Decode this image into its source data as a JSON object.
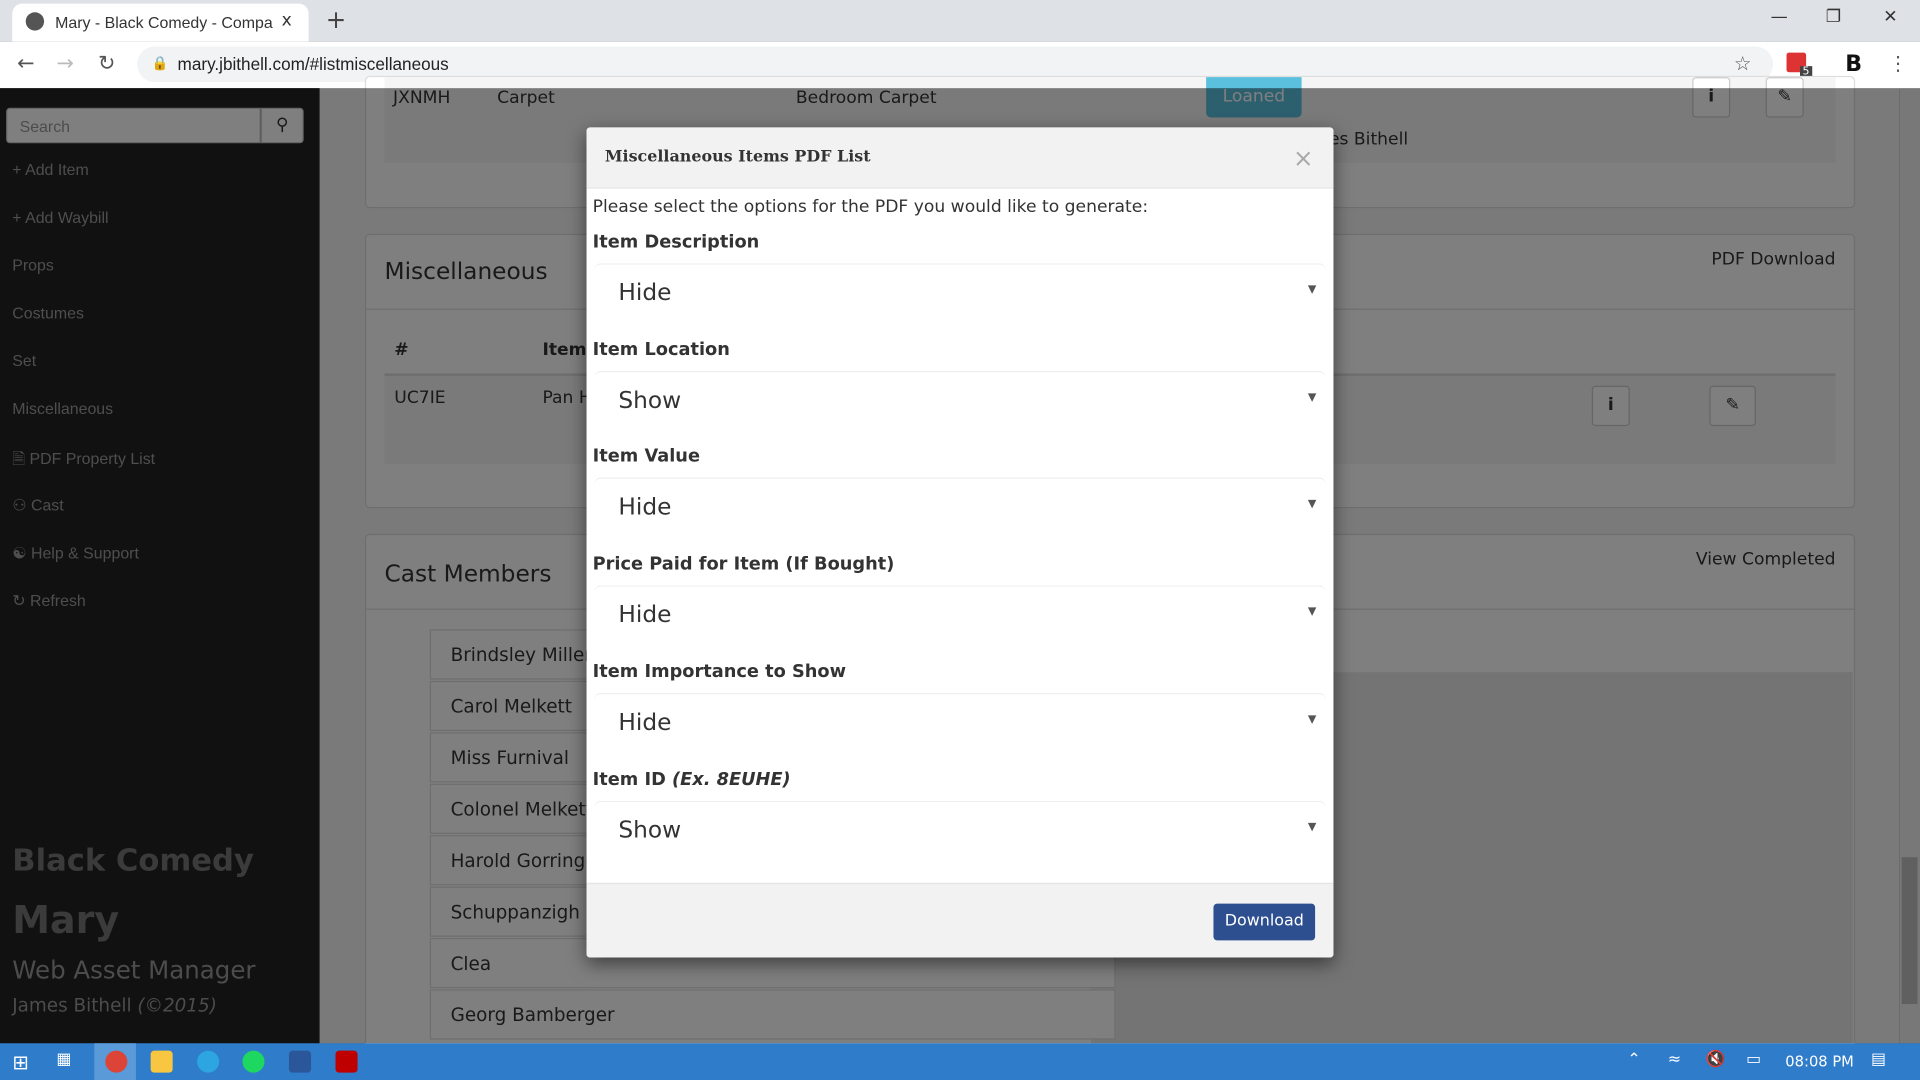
{
  "browser": {
    "tab_title": "Mary - Black Comedy - Company",
    "url": "mary.jbithell.com/#listmiscellaneous",
    "new_tab": "+",
    "tab_close": "x",
    "extension_badge": "5"
  },
  "sidebar": {
    "search_placeholder": "Search",
    "items": [
      {
        "label": "+ Add Item",
        "icon": "plus-icon"
      },
      {
        "label": "+ Add Waybill",
        "icon": "plus-icon"
      },
      {
        "label": "Props"
      },
      {
        "label": "Costumes"
      },
      {
        "label": "Set"
      },
      {
        "label": "Miscellaneous"
      },
      {
        "label": "PDF Property List",
        "icon": "file-pdf-icon"
      },
      {
        "label": "Cast",
        "icon": "users-icon"
      },
      {
        "label": "Help & Support",
        "icon": "globe-icon"
      },
      {
        "label": "Refresh",
        "icon": "refresh-icon"
      }
    ],
    "brand": {
      "production": "Black Comedy",
      "company": "Mary",
      "app": "Web Asset Manager",
      "author": "James Bithell",
      "copyright": "(©2015)"
    }
  },
  "background": {
    "top_row": {
      "id": "JXNMH",
      "type": "Carpet",
      "description": "Bedroom Carpet",
      "status": "Loaned",
      "person": "James Bithell"
    },
    "misc_panel": {
      "title": "Miscellaneous",
      "action": "PDF Download",
      "headers": [
        "#",
        "Item"
      ],
      "row": {
        "id": "UC7IE",
        "name": "Pan H"
      }
    },
    "cast_panel": {
      "title": "Cast Members",
      "action": "View Completed",
      "members": [
        "Brindsley Miller",
        "Carol Melkett",
        "Miss Furnival",
        "Colonel Melkett",
        "Harold Gorringe",
        "Schuppanzigh",
        "Clea",
        "Georg Bamberger"
      ]
    }
  },
  "modal": {
    "title": "Miscellaneous Items PDF List",
    "close": "×",
    "intro": "Please select the options for the PDF you would like to generate:",
    "fields": [
      {
        "label": "Item Description",
        "value": "Hide"
      },
      {
        "label": "Item Location",
        "value": "Show"
      },
      {
        "label": "Item Value",
        "value": "Hide"
      },
      {
        "label": "Price Paid for Item (If Bought)",
        "value": "Hide"
      },
      {
        "label": "Item Importance to Show",
        "value": "Hide"
      },
      {
        "label": "Item ID",
        "label_hint": "(Ex. 8EUHE)",
        "value": "Show"
      }
    ],
    "download": "Download"
  },
  "taskbar": {
    "time": "08:08 PM"
  },
  "colors": {
    "sidebar": "#222222",
    "loaned": "#5bc0de",
    "download": "#2e4f8f",
    "taskbar": "#2f7ccb"
  }
}
